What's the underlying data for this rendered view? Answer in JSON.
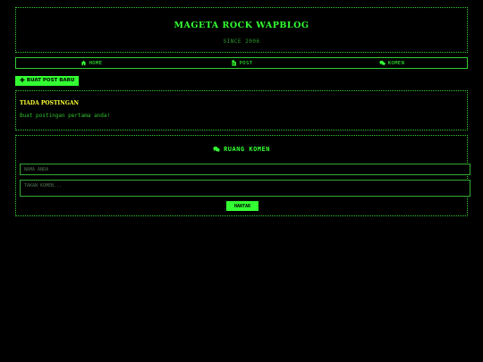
{
  "site": {
    "title": "MAGETA ROCK WAPBLOG",
    "subtitle": "SINCE 2006"
  },
  "nav": [
    {
      "label": "HOME",
      "icon": "home-icon"
    },
    {
      "label": "POST",
      "icon": "file-icon"
    },
    {
      "label": "KOMEN",
      "icon": "comments-icon"
    }
  ],
  "new_post_button": {
    "label": "BUAT POST BARU",
    "icon": "plus-icon"
  },
  "posts": {
    "title": "TIADA POSTINGAN",
    "message": "Buat postingan pertama anda!"
  },
  "comments": {
    "title": "RUANG KOMEN",
    "icon": "comments-icon",
    "name_placeholder": "NAMA ANDA",
    "comment_placeholder": "TAKAN KOMEN...",
    "submit_label": "HANTAR"
  },
  "colors": {
    "background": "#000000",
    "accent": "#33ff33",
    "highlight": "#ffff33"
  }
}
